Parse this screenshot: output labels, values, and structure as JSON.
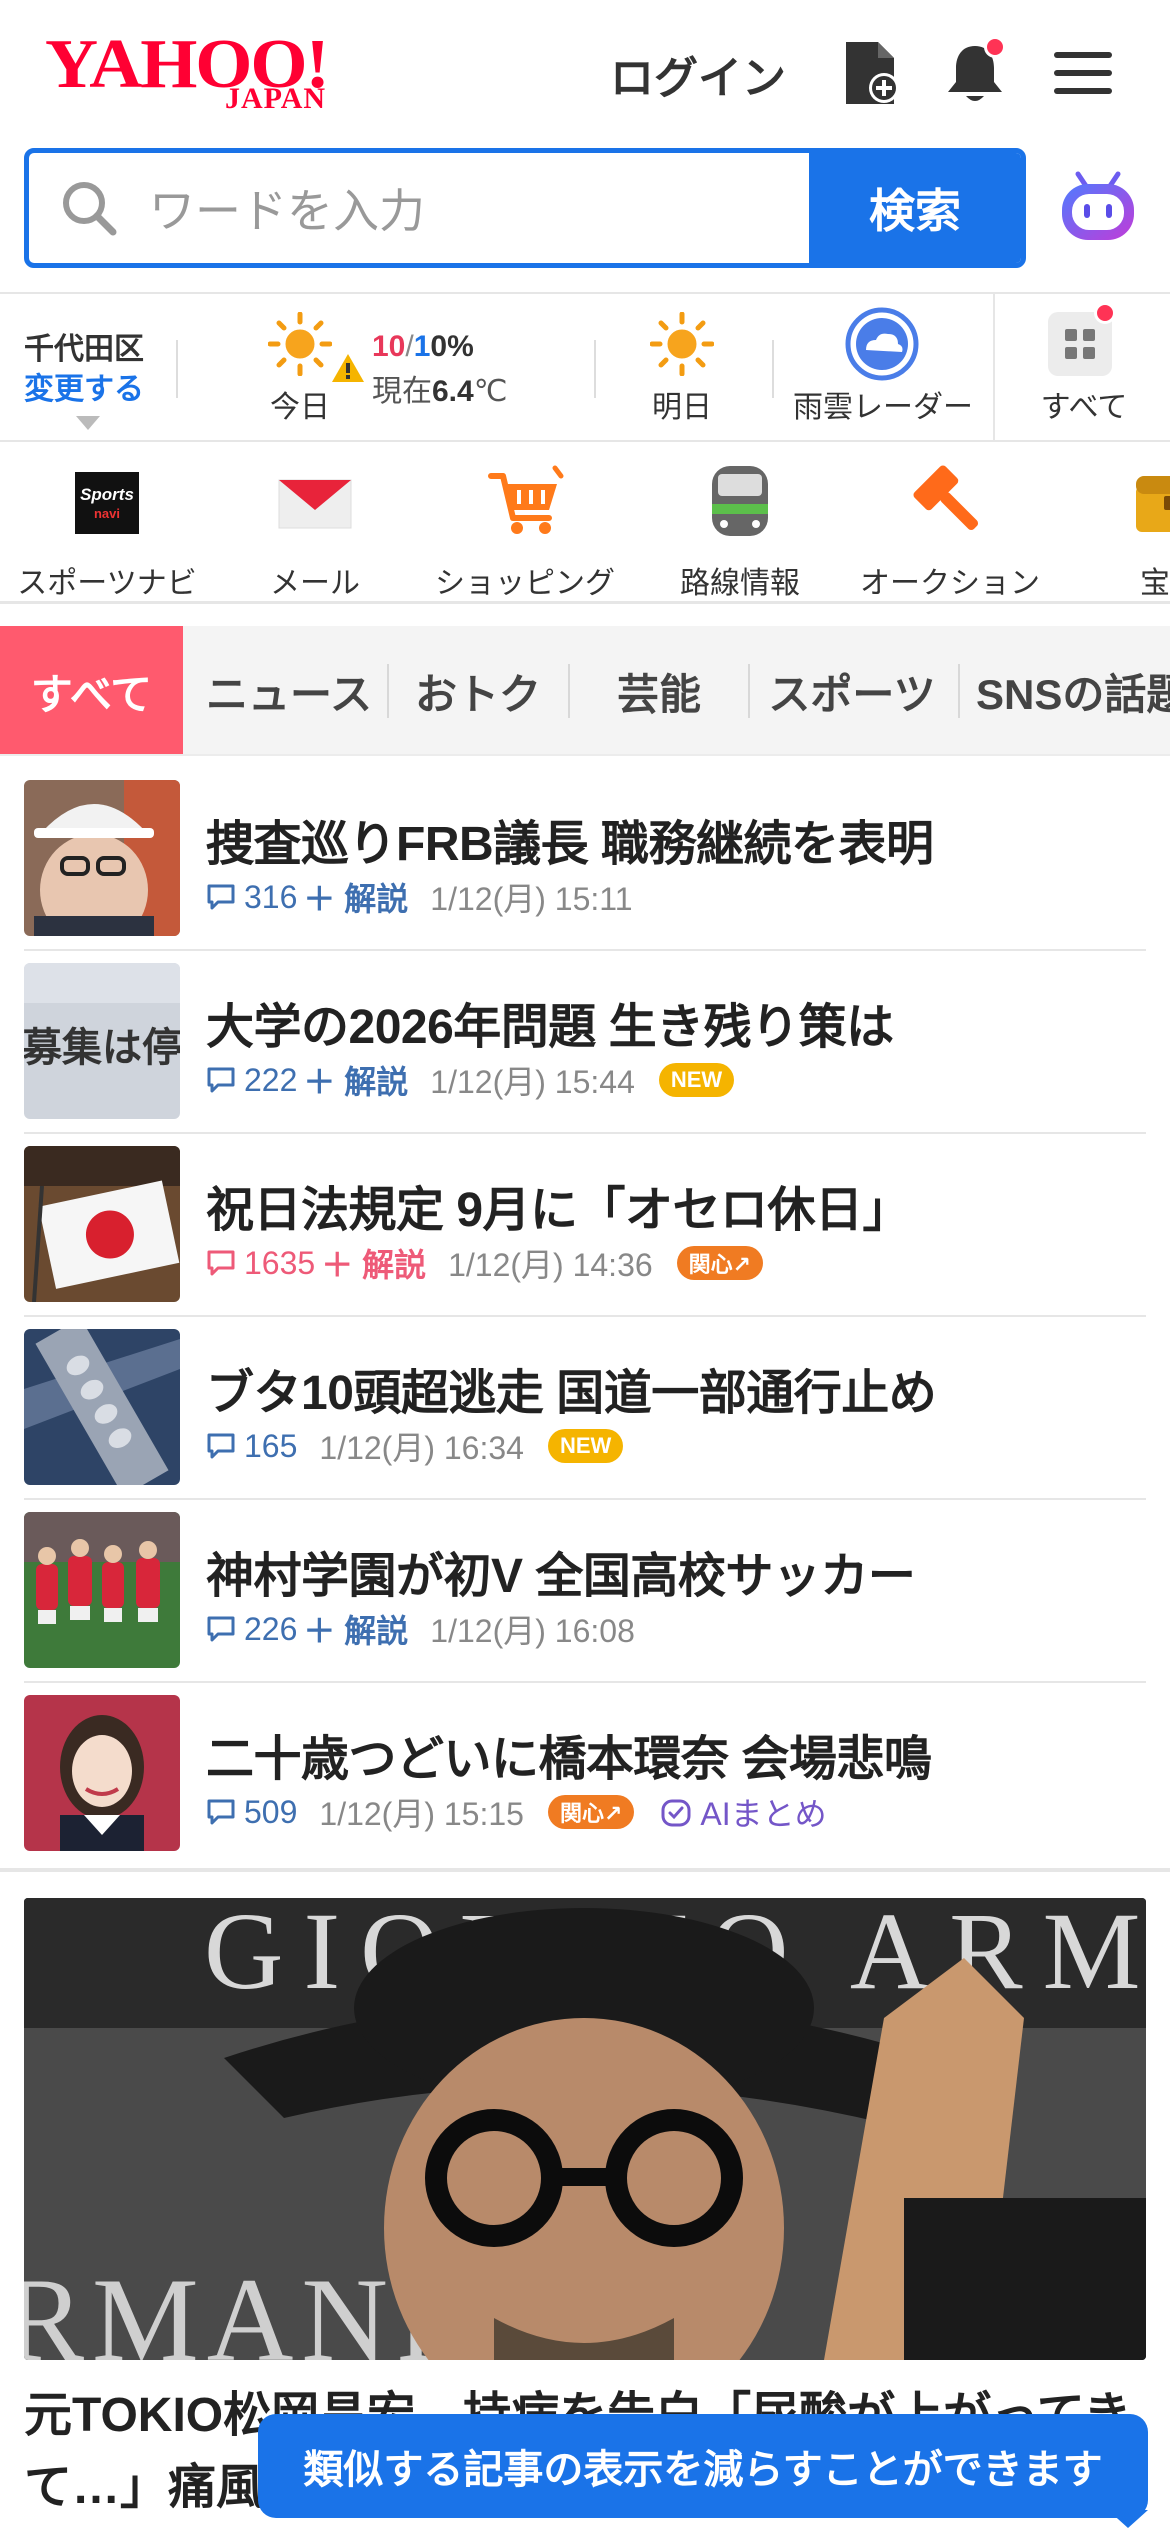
{
  "header": {
    "logo_main": "YAHOO!",
    "logo_sub": "JAPAN",
    "login_label": "ログイン"
  },
  "search": {
    "placeholder": "ワードを入力",
    "button_label": "検索"
  },
  "weather": {
    "area": "千代田区",
    "change_label": "変更する",
    "today_label": "今日",
    "high": "10",
    "slash": "/",
    "low": "1",
    "rain": "0%",
    "now_prefix": "現在",
    "now_temp": "6.4",
    "now_unit": "℃",
    "tomorrow_label": "明日",
    "radar_label": "雨雲レーダー",
    "all_label": "すべて"
  },
  "services": [
    {
      "label": "スポーツナビ",
      "icon": "sportsnavi-icon"
    },
    {
      "label": "メール",
      "icon": "mail-icon"
    },
    {
      "label": "ショッピング",
      "icon": "shopping-cart-icon"
    },
    {
      "label": "路線情報",
      "icon": "train-icon"
    },
    {
      "label": "オークション",
      "icon": "auction-hammer-icon"
    },
    {
      "label": "宝箱",
      "icon": "treasure-box-icon"
    }
  ],
  "tabs": [
    {
      "label": "すべて",
      "active": true
    },
    {
      "label": "ニュース"
    },
    {
      "label": "おトク"
    },
    {
      "label": "芸能"
    },
    {
      "label": "スポーツ"
    },
    {
      "label": "SNSの話題"
    }
  ],
  "news": [
    {
      "title": "捜査巡りFRB議長 職務継続を表明",
      "comments": "316",
      "kaisetsu": "＋ 解説",
      "date": "1/12(月) 15:11"
    },
    {
      "title": "大学の2026年問題 生き残り策は",
      "comments": "222",
      "kaisetsu": "＋ 解説",
      "date": "1/12(月) 15:44",
      "tag": "NEW"
    },
    {
      "title": "祝日法規定 9月に「オセロ休日」",
      "comments": "1635",
      "kaisetsu": "＋ 解説",
      "date": "1/12(月) 14:36",
      "tag": "関心↗"
    },
    {
      "title": "ブタ10頭超逃走 国道一部通行止め",
      "comments": "165",
      "date": "1/12(月) 16:34",
      "tag": "NEW"
    },
    {
      "title": "神村学園が初V 全国高校サッカー",
      "comments": "226",
      "kaisetsu": "＋ 解説",
      "date": "1/12(月) 16:08"
    },
    {
      "title": "二十歳つどいに橋本環奈 会場悲鳴",
      "comments": "509",
      "date": "1/12(月) 15:15",
      "tag": "関心↗",
      "ai": "AIまとめ"
    }
  ],
  "feature": {
    "image_text_top": "GIORGIO ARMANI",
    "image_text_bottom": "RMANI",
    "title": "元TOKIO松岡昌宏　持病を告白「尿酸が上がってきて…」痛風"
  },
  "toast": "類似する記事の表示を減らすことができます",
  "colors": {
    "brand_red": "#ff0033",
    "accent_blue": "#1a73e8",
    "tab_active": "#ff5a6e",
    "tag_new": "#f5b400",
    "tag_hot": "#f07b22"
  }
}
